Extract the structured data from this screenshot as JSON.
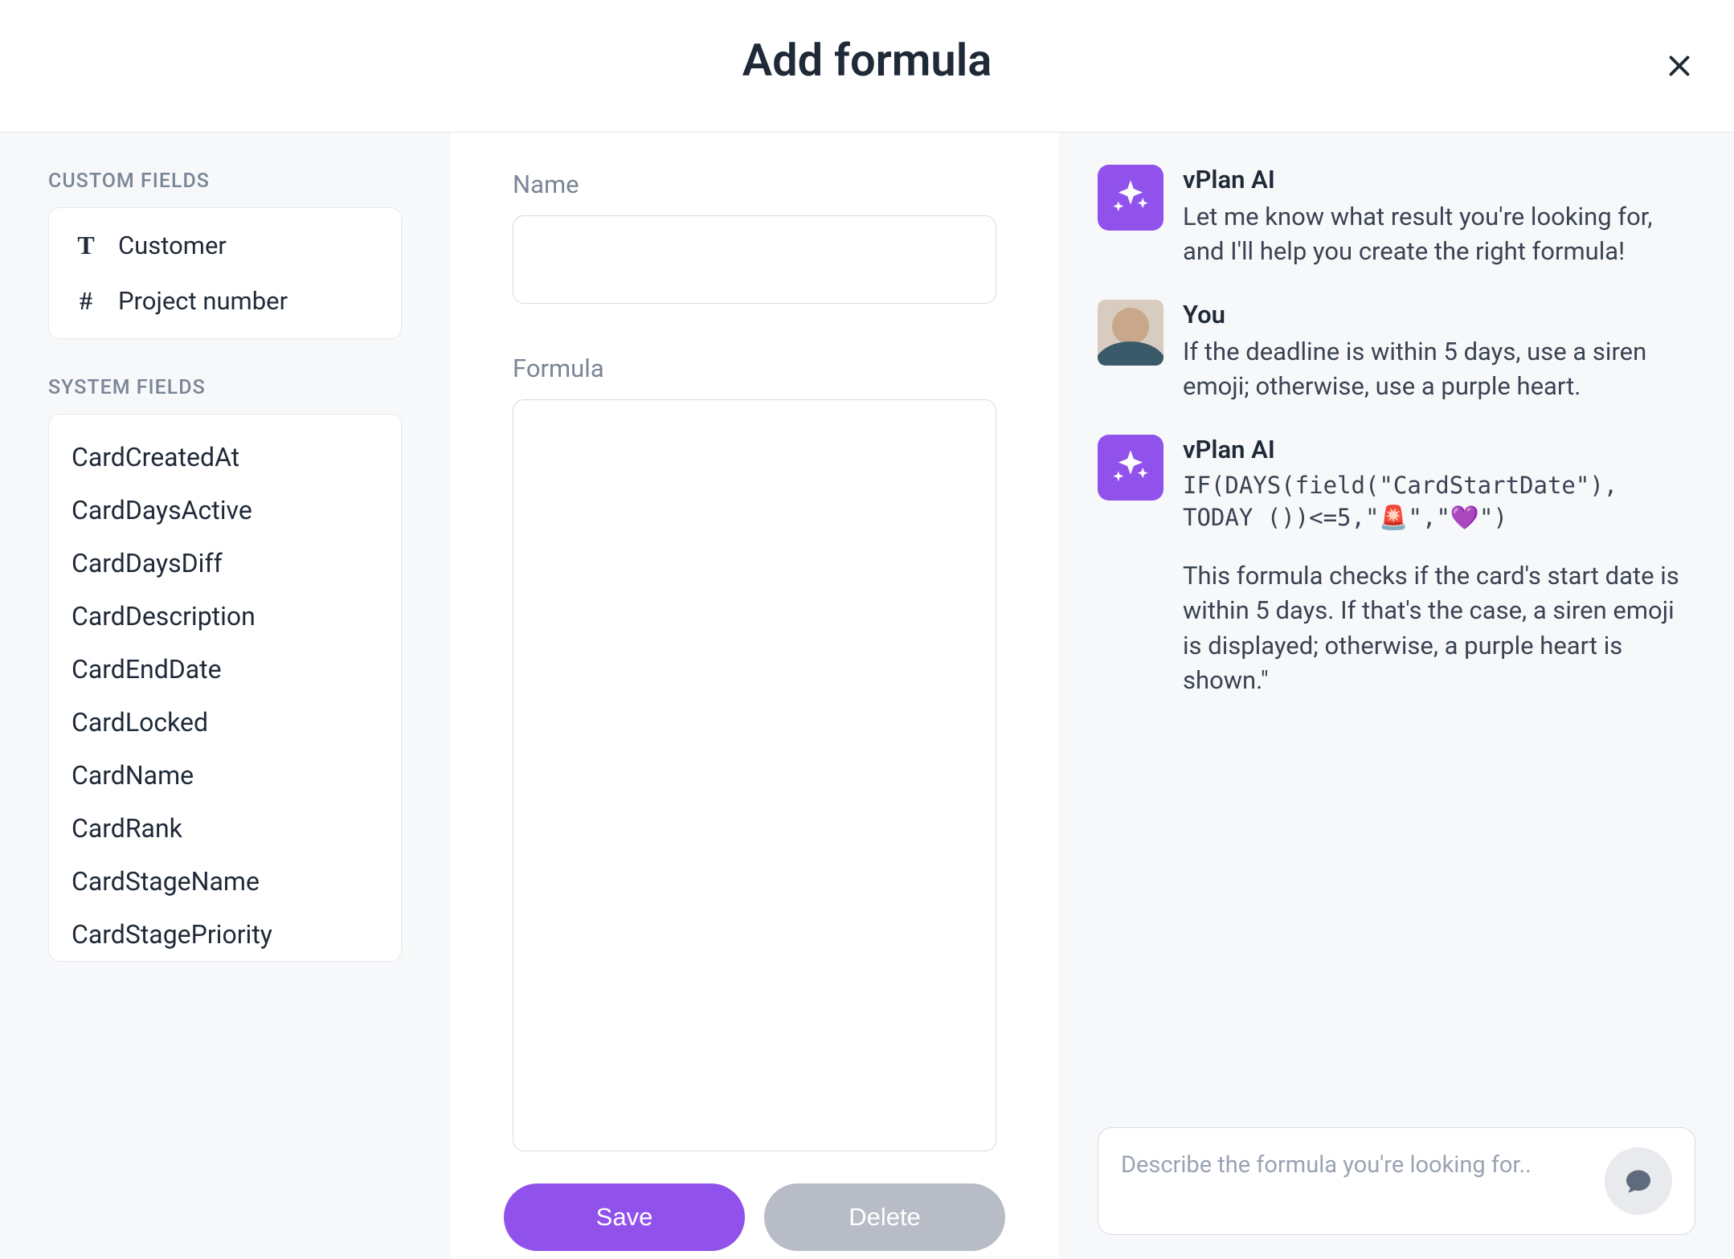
{
  "modal": {
    "title": "Add formula"
  },
  "sidebar": {
    "custom_label": "CUSTOM FIELDS",
    "custom_fields": [
      {
        "icon": "T",
        "label": "Customer"
      },
      {
        "icon": "#",
        "label": "Project number"
      }
    ],
    "system_label": "SYSTEM FIELDS",
    "system_fields": [
      "CardCreatedAt",
      "CardDaysActive",
      "CardDaysDiff",
      "CardDescription",
      "CardEndDate",
      "CardLocked",
      "CardName",
      "CardRank",
      "CardStageName",
      "CardStagePriority"
    ]
  },
  "form": {
    "name_label": "Name",
    "name_value": "",
    "formula_label": "Formula",
    "formula_value": "",
    "save_label": "Save",
    "delete_label": "Delete"
  },
  "chat": {
    "messages": [
      {
        "role": "ai",
        "name": "vPlan AI",
        "text": "Let me know what result you're looking for, and I'll help you create the right formula!"
      },
      {
        "role": "user",
        "name": "You",
        "text": "If the deadline is within 5 days, use a siren emoji; otherwise, use a purple heart."
      },
      {
        "role": "ai",
        "name": "vPlan AI",
        "code": "IF(DAYS(field(\"CardStartDate\"), TODAY ())<=5,\"🚨\",\"💜\")",
        "text": "This formula checks if the card's start date is within 5 days. If that's the case, a siren emoji is displayed; otherwise, a purple heart is shown.\""
      }
    ],
    "input_placeholder": "Describe the formula you're looking for.."
  }
}
